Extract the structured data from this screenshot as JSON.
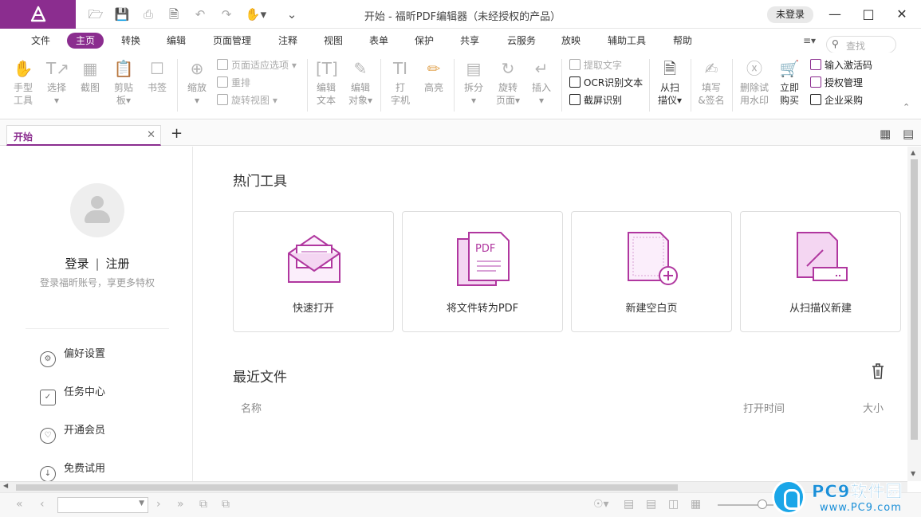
{
  "app": {
    "title": "开始 - 福昕PDF编辑器（未经授权的产品）",
    "login_status": "未登录",
    "brand_color": "#8b2d8f"
  },
  "menu": {
    "items": [
      "文件",
      "主页",
      "转换",
      "编辑",
      "页面管理",
      "注释",
      "视图",
      "表单",
      "保护",
      "共享",
      "云服务",
      "放映",
      "辅助工具",
      "帮助"
    ],
    "active": "主页",
    "search_placeholder": "查找"
  },
  "ribbon": {
    "hand_tool": [
      "手型",
      "工具"
    ],
    "select": [
      "选择",
      ""
    ],
    "snapshot": "截图",
    "clipboard": [
      "剪贴",
      "板"
    ],
    "bookmark": "书签",
    "zoom": "缩放",
    "fit_page_options": "页面适应选项",
    "reflow": "重排",
    "rotate_view": "旋转视图",
    "edit_text": [
      "编辑",
      "文本"
    ],
    "edit_object": [
      "编辑",
      "对象"
    ],
    "typewriter": [
      "打",
      "字机"
    ],
    "highlight": "高亮",
    "split": "拆分",
    "rotate_page": [
      "旋转",
      "页面"
    ],
    "insert": "插入",
    "extract_text": "提取文字",
    "ocr": "OCR识别文本",
    "screen_ocr": "截屏识别",
    "from_scanner": [
      "从扫",
      "描仪"
    ],
    "fill_sign": [
      "填写",
      "&签名"
    ],
    "remove_watermark": [
      "删除试",
      "用水印"
    ],
    "buy_now": [
      "立即",
      "购买"
    ],
    "enter_activation": "输入激活码",
    "license_mgmt": "授权管理",
    "enterprise": "企业采购"
  },
  "tabs": {
    "current": "开始"
  },
  "left_panel": {
    "login": "登录",
    "separator": "|",
    "register": "注册",
    "subtitle": "登录福昕账号，享更多特权",
    "items": [
      {
        "label": "偏好设置",
        "icon": "preferences-icon"
      },
      {
        "label": "任务中心",
        "icon": "task-center-icon"
      },
      {
        "label": "开通会员",
        "icon": "membership-icon"
      },
      {
        "label": "免费试用",
        "icon": "free-trial-icon"
      }
    ]
  },
  "main": {
    "hot_tools_title": "热门工具",
    "cards": [
      {
        "label": "快速打开",
        "icon": "open-envelope-icon"
      },
      {
        "label": "将文件转为PDF",
        "icon": "convert-to-pdf-icon",
        "icon_text": "PDF"
      },
      {
        "label": "新建空白页",
        "icon": "new-blank-page-icon"
      },
      {
        "label": "从扫描仪新建",
        "icon": "scanner-new-icon"
      }
    ],
    "recent_title": "最近文件",
    "columns": [
      "名称",
      "打开时间",
      "大小"
    ]
  },
  "watermark": {
    "name": "PC9软件园",
    "url": "www.PC9.com"
  }
}
